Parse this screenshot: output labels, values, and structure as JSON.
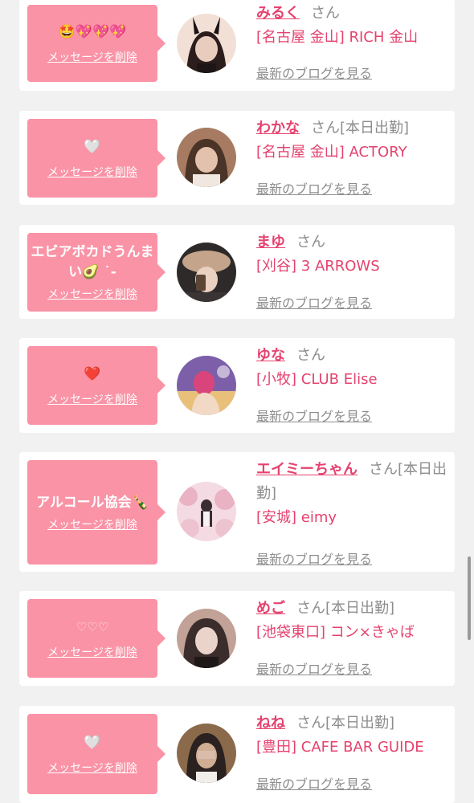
{
  "entries": [
    {
      "message": "🤩💖💖💖",
      "delete_label": "メッセージを削除",
      "name": "みるく",
      "suffix": "さん",
      "shop": "[名古屋 金山] RICH 金山",
      "blog_label": "最新のブログを見る",
      "avatar_icon": "girl-photo-bunny-ears",
      "avatar_colors": [
        "#2b1d1c",
        "#d9b7a8",
        "#f2dfd6"
      ]
    },
    {
      "message": "🤍",
      "delete_label": "メッセージを削除",
      "name": "わかな",
      "suffix": "さん[本日出勤]",
      "shop": "[名古屋 金山] ACTORY",
      "blog_label": "最新のブログを見る",
      "avatar_icon": "girl-photo",
      "avatar_colors": [
        "#4a3427",
        "#e2c2ad",
        "#a77b61"
      ]
    },
    {
      "message": "エビアボカドうんまい🥑 ˙-",
      "delete_label": "メッセージを削除",
      "name": "まゆ",
      "suffix": "さん",
      "shop": "[刈谷] 3 ARROWS",
      "blog_label": "最新のブログを見る",
      "avatar_icon": "girl-photo-hat",
      "avatar_colors": [
        "#5b4636",
        "#c4a58c",
        "#2e2a2a"
      ]
    },
    {
      "message": "❤️",
      "delete_label": "メッセージを削除",
      "name": "ゆな",
      "suffix": "さん",
      "shop": "[小牧] CLUB Elise",
      "blog_label": "最新のブログを見る",
      "avatar_icon": "girl-photo-mask",
      "avatar_colors": [
        "#7c5fa8",
        "#d9457a",
        "#e9c07a"
      ]
    },
    {
      "message": "アルコール協会🍾",
      "delete_label": "メッセージを削除",
      "name": "エイミーちゃん",
      "suffix": "さん[本日出勤]",
      "shop": "[安城] eimy",
      "blog_label": "最新のブログを見る",
      "avatar_icon": "girl-photo-flowers",
      "avatar_colors": [
        "#f4dbe3",
        "#e9b3c4",
        "#3a2e33"
      ]
    },
    {
      "message": "♡♡♡",
      "delete_label": "メッセージを削除",
      "name": "めご",
      "suffix": "さん[本日出勤]",
      "shop": "[池袋東口] コン×きゃば",
      "blog_label": "最新のブログを見る",
      "avatar_icon": "girl-photo",
      "avatar_colors": [
        "#3b2d2c",
        "#ead3ca",
        "#c2a196"
      ]
    },
    {
      "message": "🤍",
      "delete_label": "メッセージを削除",
      "name": "ねね",
      "suffix": "さん[本日出勤]",
      "shop": "[豊田] CAFE BAR GUIDE",
      "blog_label": "最新のブログを見る",
      "avatar_icon": "girl-photo-blurred",
      "avatar_colors": [
        "#2a2220",
        "#cfae94",
        "#8a6a4a"
      ]
    }
  ]
}
